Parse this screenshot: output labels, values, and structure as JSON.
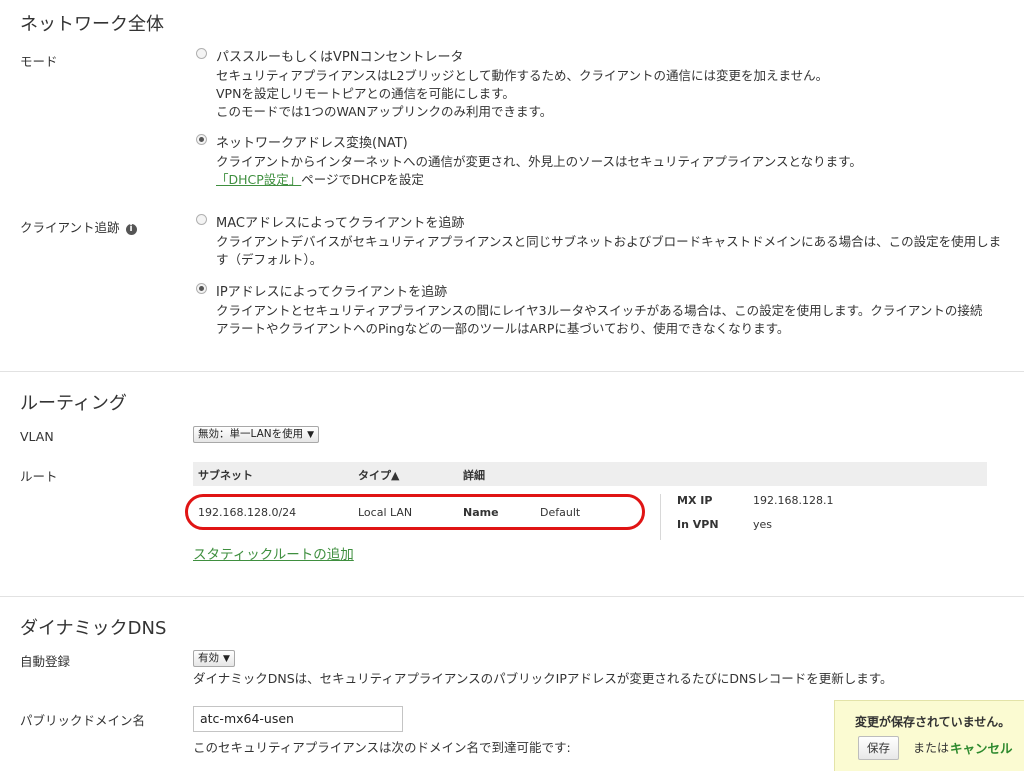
{
  "network": {
    "title": "ネットワーク全体",
    "mode": {
      "label": "モード",
      "options": [
        {
          "title": "パススルーもしくはVPNコンセントレータ",
          "checked": false,
          "lines": [
            "セキュリティアプライアンスはL2ブリッジとして動作するため、クライアントの通信には変更を加えません。",
            "VPNを設定しリモートピアとの通信を可能にします。",
            "このモードでは1つのWANアップリンクのみ利用できます。"
          ]
        },
        {
          "title": "ネットワークアドレス変換(NAT)",
          "checked": true,
          "lines": [
            "クライアントからインターネットへの通信が変更され、外見上のソースはセキュリティアプライアンスとなります。"
          ],
          "link": "「DHCP設定」",
          "link_suffix": "ページでDHCPを設定"
        }
      ]
    },
    "client_tracking": {
      "label": "クライアント追跡",
      "info_icon": "i",
      "options": [
        {
          "title": "MACアドレスによってクライアントを追跡",
          "checked": false,
          "lines": [
            "クライアントデバイスがセキュリティアプライアンスと同じサブネットおよびブロードキャストドメインにある場合は、この設定を使用しま",
            "す（デフォルト）。"
          ]
        },
        {
          "title": "IPアドレスによってクライアントを追跡",
          "checked": true,
          "lines": [
            "クライアントとセキュリティアプライアンスの間にレイヤ3ルータやスイッチがある場合は、この設定を使用します。クライアントの接続",
            "アラートやクライアントへのPingなどの一部のツールはARPに基づいており、使用できなくなります。"
          ]
        }
      ]
    }
  },
  "routing": {
    "title": "ルーティング",
    "vlan": {
      "label": "VLAN",
      "value": "無効：単一LANを使用"
    },
    "routes": {
      "label": "ルート",
      "headers": {
        "subnet": "サブネット",
        "type": "タイプ▲",
        "details": "詳細"
      },
      "row": {
        "subnet": "192.168.128.0/24",
        "type": "Local LAN",
        "name_label": "Name",
        "name_value": "Default",
        "mxip_label": "MX IP",
        "mxip_value": "192.168.128.1",
        "invpn_label": "In VPN",
        "invpn_value": "yes"
      },
      "add_link": "スタティックルートの追加"
    }
  },
  "ddns": {
    "title": "ダイナミックDNS",
    "auto_reg": {
      "label": "自動登録",
      "value": "有効",
      "desc": "ダイナミックDNSは、セキュリティアプライアンスのパブリックIPアドレスが変更されるたびにDNSレコードを更新します。"
    },
    "public_domain": {
      "label": "パブリックドメイン名",
      "value": "atc-mx64-usen",
      "desc": "このセキュリティアプライアンスは次のドメイン名で到達可能です:"
    }
  },
  "toast": {
    "message": "変更が保存されていません。",
    "save": "保存",
    "or": "または",
    "cancel": "キャンセル"
  },
  "colors": {
    "link": "#3f8f3f",
    "highlight": "#e01414",
    "toast_bg": "#fbfbd2"
  }
}
